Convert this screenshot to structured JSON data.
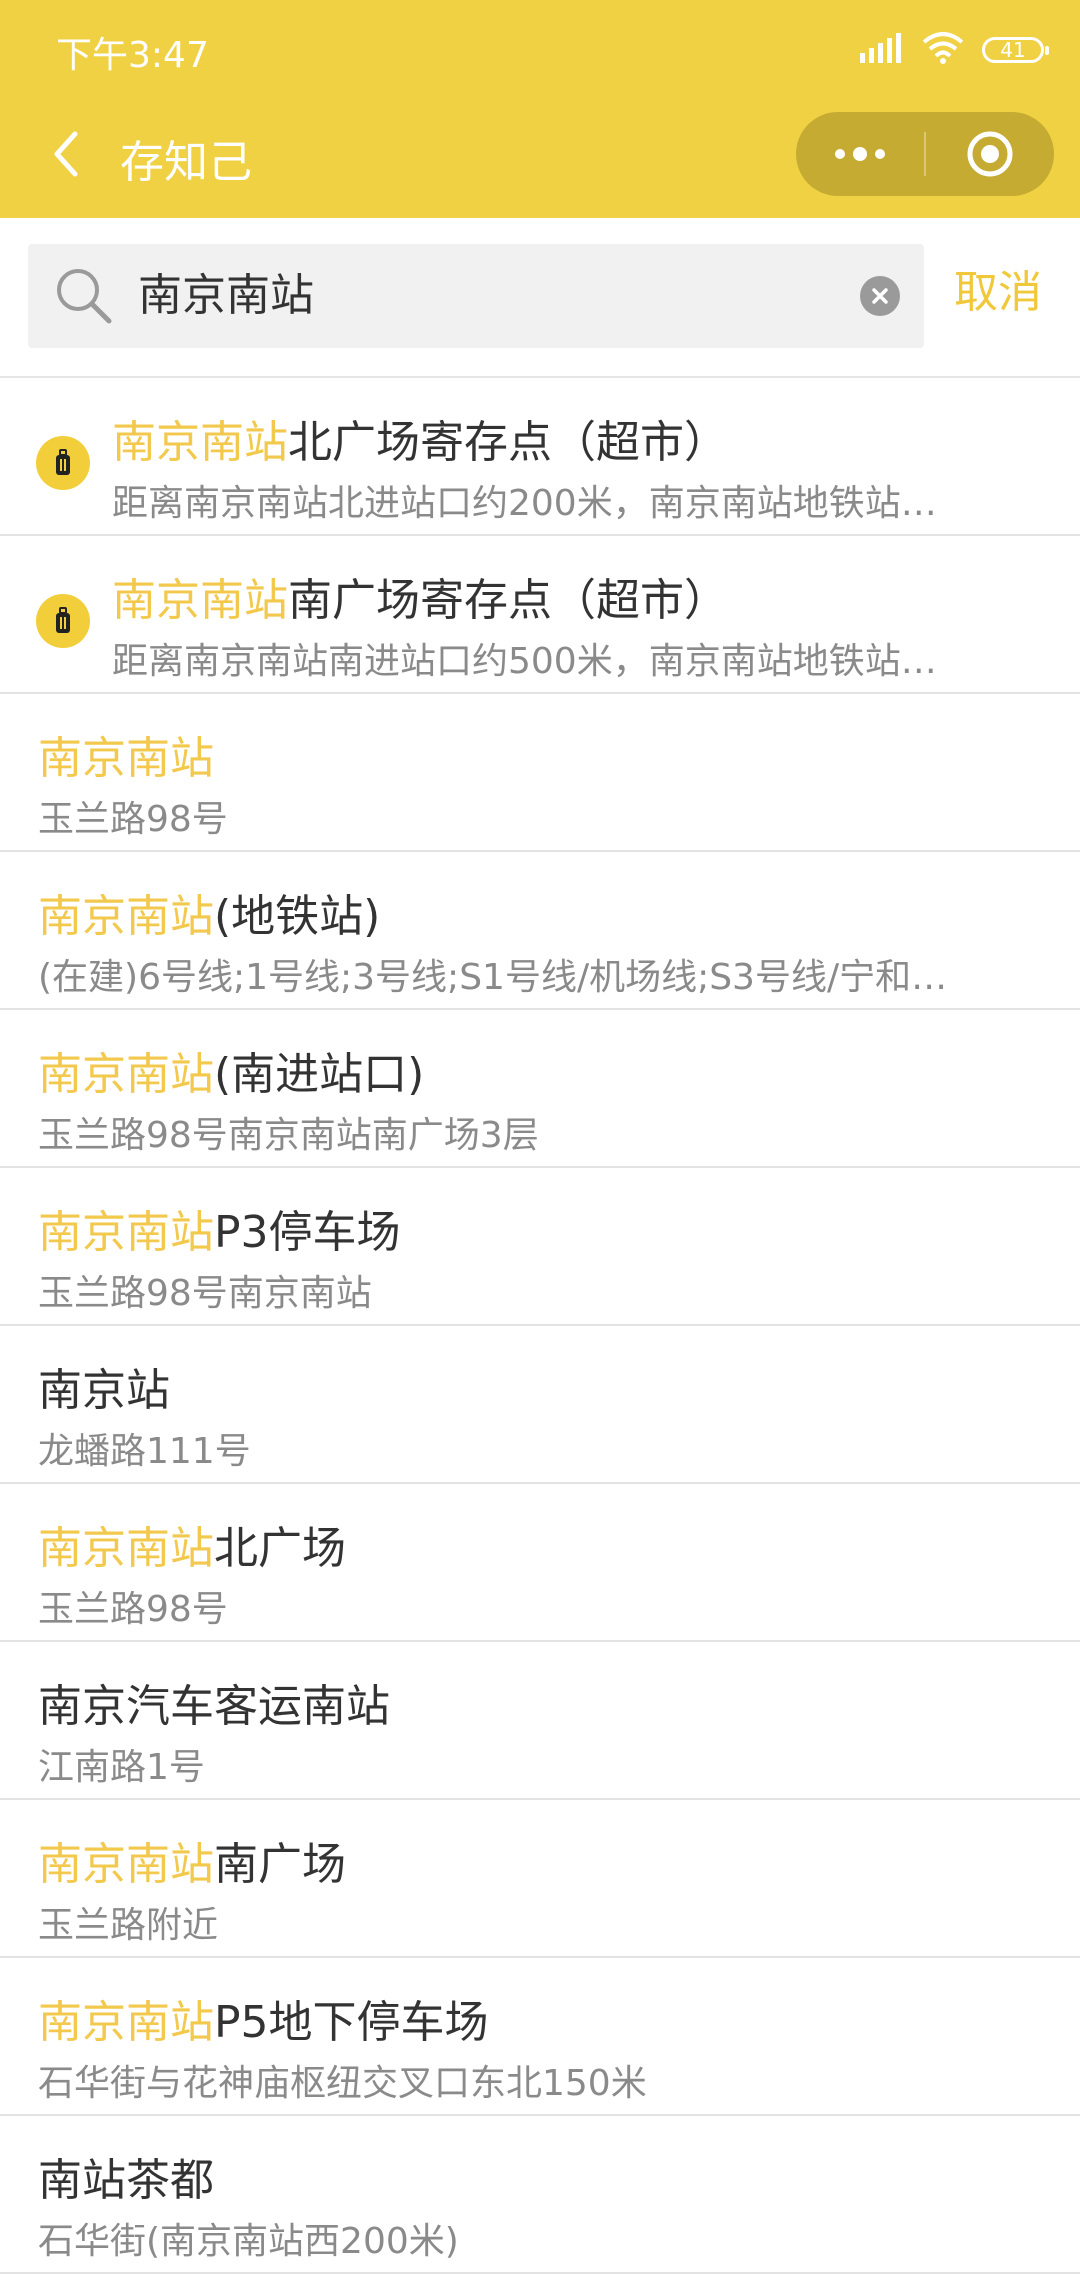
{
  "status_bar": {
    "time": "下午3:47",
    "battery": "41"
  },
  "nav": {
    "title": "存知己"
  },
  "search": {
    "value": "南京南站",
    "cancel_label": "取消"
  },
  "results": [
    {
      "type": "storage",
      "highlight": "南京南站",
      "rest": "北广场寄存点（超市）",
      "sub": "距离南京南站北进站口约200米，南京南站地铁站…"
    },
    {
      "type": "storage",
      "highlight": "南京南站",
      "rest": "南广场寄存点（超市）",
      "sub": "距离南京南站南进站口约500米，南京南站地铁站…"
    },
    {
      "type": "place",
      "highlight": "南京南站",
      "rest": "",
      "sub": "玉兰路98号"
    },
    {
      "type": "place",
      "highlight": "南京南站",
      "rest": "(地铁站)",
      "sub": "(在建)6号线;1号线;3号线;S1号线/机场线;S3号线/宁和…"
    },
    {
      "type": "place",
      "highlight": "南京南站",
      "rest": "(南进站口)",
      "sub": "玉兰路98号南京南站南广场3层"
    },
    {
      "type": "place",
      "highlight": "南京南站",
      "rest": "P3停车场",
      "sub": "玉兰路98号南京南站"
    },
    {
      "type": "place",
      "highlight": "",
      "rest": "南京站",
      "sub": "龙蟠路111号"
    },
    {
      "type": "place",
      "highlight": "南京南站",
      "rest": "北广场",
      "sub": "玉兰路98号"
    },
    {
      "type": "place",
      "highlight": "",
      "rest": "南京汽车客运南站",
      "sub": "江南路1号"
    },
    {
      "type": "place",
      "highlight": "南京南站",
      "rest": "南广场",
      "sub": "玉兰路附近"
    },
    {
      "type": "place",
      "highlight": "南京南站",
      "rest": "P5地下停车场",
      "sub": "石华街与花神庙枢纽交叉口东北150米"
    },
    {
      "type": "place",
      "highlight": "",
      "rest": "南站茶都",
      "sub": "石华街(南京南站西200米)"
    }
  ],
  "colors": {
    "header": "#f0d143",
    "highlight": "#f2c94c",
    "accent": "#f0c83a"
  }
}
